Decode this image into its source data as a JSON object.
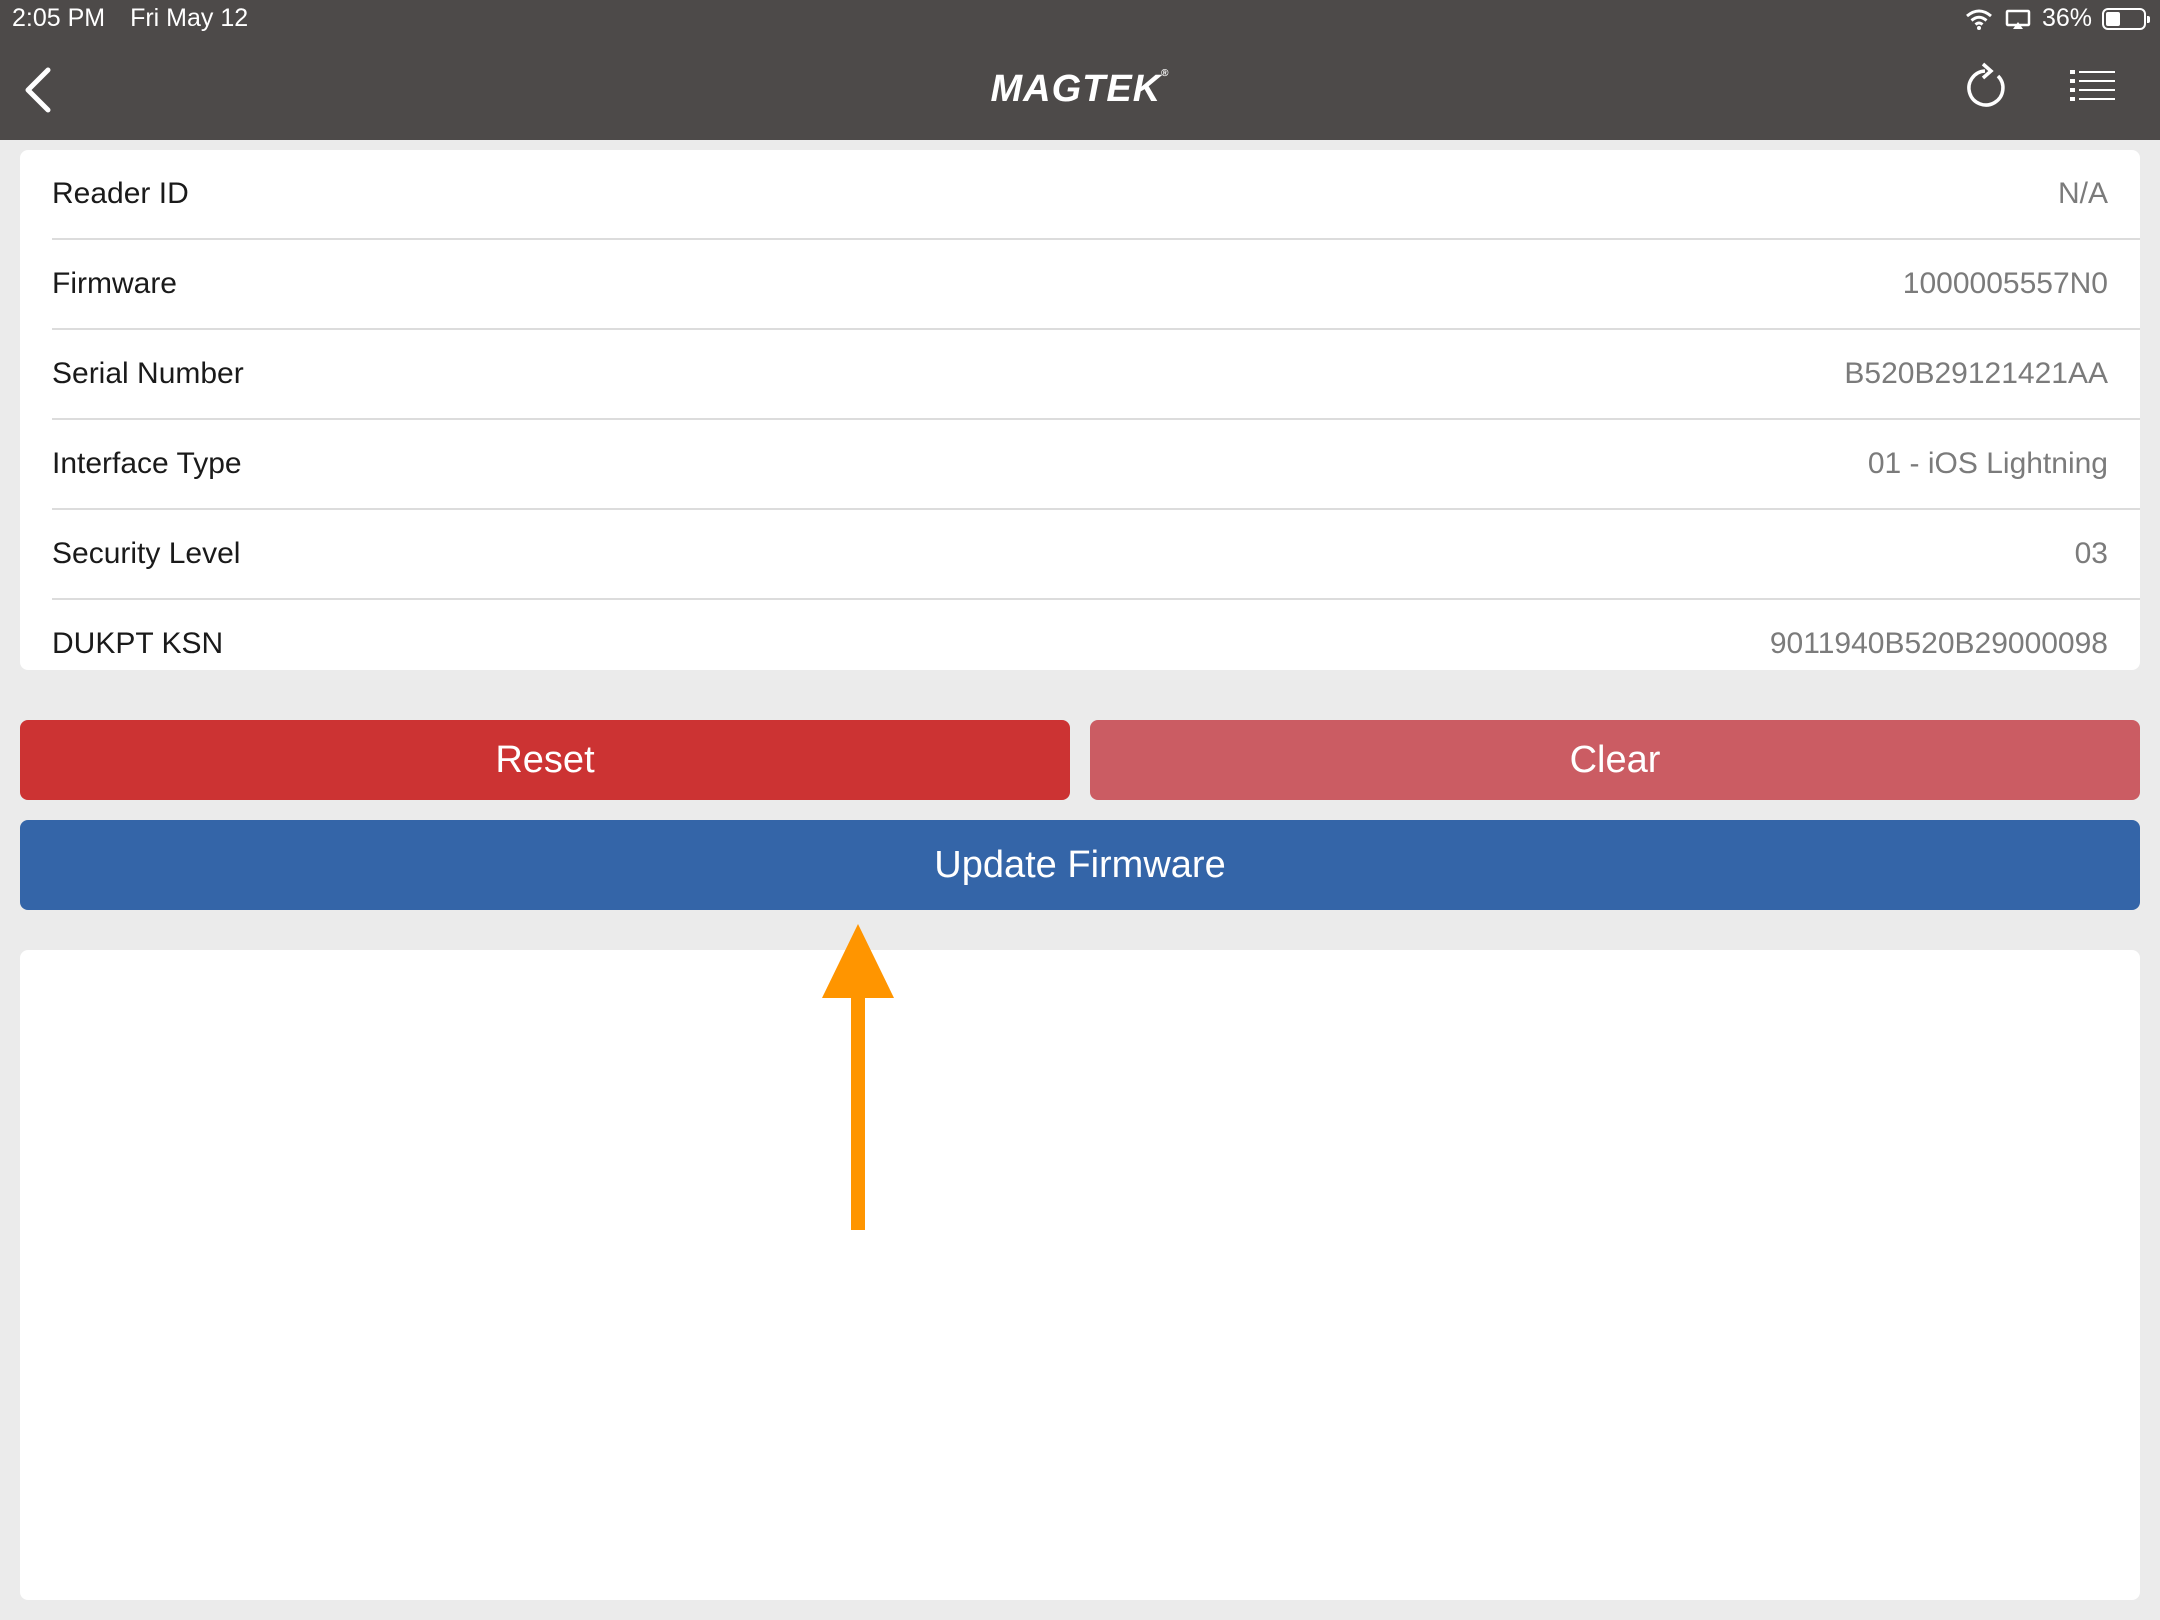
{
  "status_bar": {
    "time": "2:05 PM",
    "date": "Fri May 12",
    "battery": "36%",
    "icons": [
      "wifi-icon",
      "airplay-icon",
      "battery-icon"
    ]
  },
  "nav": {
    "logo": "MAGTEK",
    "logo_mark": "®",
    "icons": [
      "chevron-left-icon",
      "refresh-icon",
      "list-menu-icon"
    ]
  },
  "device_info": [
    {
      "label": "Reader ID",
      "value": "N/A"
    },
    {
      "label": "Firmware",
      "value": "1000005557N0"
    },
    {
      "label": "Serial Number",
      "value": "B520B29121421AA"
    },
    {
      "label": "Interface Type",
      "value": "01 - iOS Lightning"
    },
    {
      "label": "Security Level",
      "value": "03"
    },
    {
      "label": "DUKPT KSN",
      "value": "9011940B520B29000098"
    }
  ],
  "buttons": {
    "reset": "Reset",
    "clear": "Clear",
    "update_firmware": "Update Firmware"
  },
  "colors": {
    "nav_bg": "#4d4a49",
    "reset": "#cc3333",
    "clear": "#cb5c63",
    "update": "#3465a8",
    "annotation_arrow": "#ff9500"
  }
}
